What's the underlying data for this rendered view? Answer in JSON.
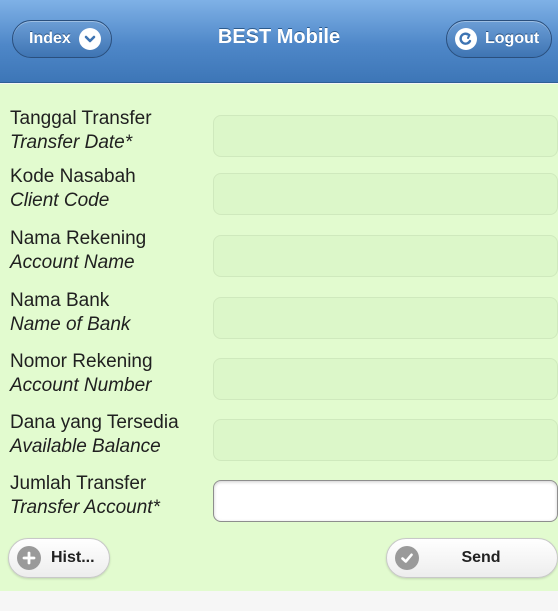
{
  "header": {
    "title": "BEST Mobile",
    "index_label": "Index",
    "logout_label": "Logout",
    "colors": {
      "bar": "#4e87c8",
      "form_bg": "#e2fbcf"
    }
  },
  "form": {
    "fields": [
      {
        "label_id": "Tanggal Transfer",
        "label_en": "Transfer Date*",
        "value": ""
      },
      {
        "label_id": "Kode Nasabah",
        "label_en": "Client Code",
        "value": ""
      },
      {
        "label_id": "Nama Rekening",
        "label_en": "Account Name",
        "value": ""
      },
      {
        "label_id": "Nama Bank",
        "label_en": "Name of Bank",
        "value": ""
      },
      {
        "label_id": "Nomor Rekening",
        "label_en": "Account Number",
        "value": ""
      },
      {
        "label_id": "Dana yang Tersedia",
        "label_en": "Available Balance",
        "value": ""
      },
      {
        "label_id": "Jumlah Transfer",
        "label_en": "Transfer Account*",
        "value": ""
      }
    ]
  },
  "footer": {
    "history_label": "Hist...",
    "send_label": "Send"
  },
  "icons": {
    "index": "chevron-down-icon",
    "logout": "logout-icon",
    "history": "plus-icon",
    "send": "check-icon"
  }
}
